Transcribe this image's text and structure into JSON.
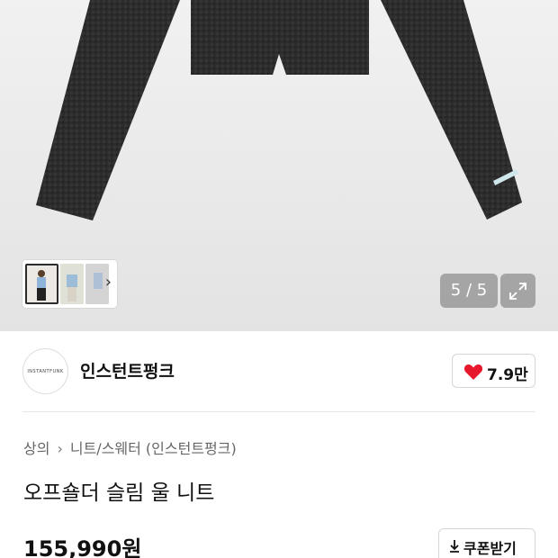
{
  "gallery": {
    "counter": "5 / 5",
    "thumbnail_next": "›"
  },
  "brand": {
    "logo_text": "INSTANTFUNK",
    "name": "인스턴트펑크",
    "likes": "7.9만"
  },
  "breadcrumb": {
    "category": "상의",
    "subcategory": "니트/스웨터 (인스턴트펑크)"
  },
  "product": {
    "title": "오프숄더 슬림 울 니트",
    "price": "155,990원"
  },
  "actions": {
    "coupon_label": "쿠폰받기"
  },
  "colors": {
    "heart": "#e8182c",
    "garment": "#2a2a2a"
  }
}
